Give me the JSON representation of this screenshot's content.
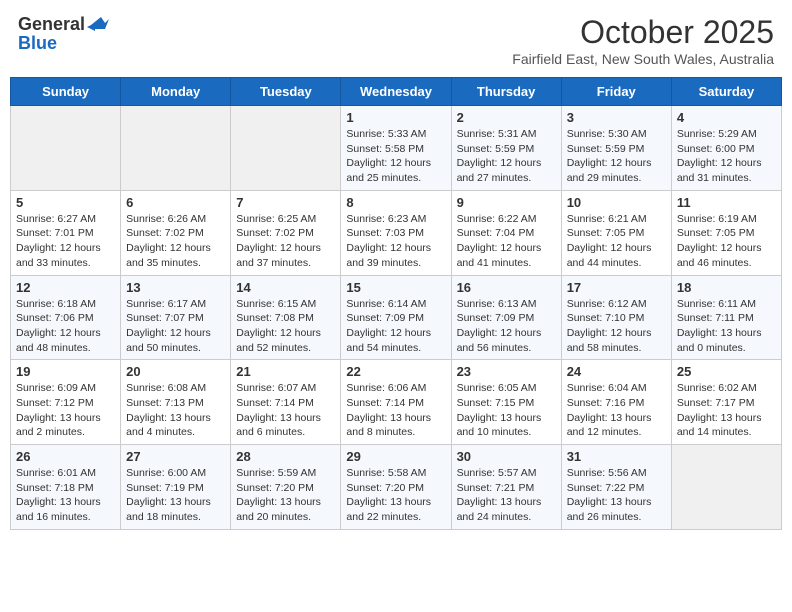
{
  "header": {
    "logo_general": "General",
    "logo_blue": "Blue",
    "month": "October 2025",
    "location": "Fairfield East, New South Wales, Australia"
  },
  "days_of_week": [
    "Sunday",
    "Monday",
    "Tuesday",
    "Wednesday",
    "Thursday",
    "Friday",
    "Saturday"
  ],
  "weeks": [
    [
      {
        "day": "",
        "info": ""
      },
      {
        "day": "",
        "info": ""
      },
      {
        "day": "",
        "info": ""
      },
      {
        "day": "1",
        "info": "Sunrise: 5:33 AM\nSunset: 5:58 PM\nDaylight: 12 hours\nand 25 minutes."
      },
      {
        "day": "2",
        "info": "Sunrise: 5:31 AM\nSunset: 5:59 PM\nDaylight: 12 hours\nand 27 minutes."
      },
      {
        "day": "3",
        "info": "Sunrise: 5:30 AM\nSunset: 5:59 PM\nDaylight: 12 hours\nand 29 minutes."
      },
      {
        "day": "4",
        "info": "Sunrise: 5:29 AM\nSunset: 6:00 PM\nDaylight: 12 hours\nand 31 minutes."
      }
    ],
    [
      {
        "day": "5",
        "info": "Sunrise: 6:27 AM\nSunset: 7:01 PM\nDaylight: 12 hours\nand 33 minutes."
      },
      {
        "day": "6",
        "info": "Sunrise: 6:26 AM\nSunset: 7:02 PM\nDaylight: 12 hours\nand 35 minutes."
      },
      {
        "day": "7",
        "info": "Sunrise: 6:25 AM\nSunset: 7:02 PM\nDaylight: 12 hours\nand 37 minutes."
      },
      {
        "day": "8",
        "info": "Sunrise: 6:23 AM\nSunset: 7:03 PM\nDaylight: 12 hours\nand 39 minutes."
      },
      {
        "day": "9",
        "info": "Sunrise: 6:22 AM\nSunset: 7:04 PM\nDaylight: 12 hours\nand 41 minutes."
      },
      {
        "day": "10",
        "info": "Sunrise: 6:21 AM\nSunset: 7:05 PM\nDaylight: 12 hours\nand 44 minutes."
      },
      {
        "day": "11",
        "info": "Sunrise: 6:19 AM\nSunset: 7:05 PM\nDaylight: 12 hours\nand 46 minutes."
      }
    ],
    [
      {
        "day": "12",
        "info": "Sunrise: 6:18 AM\nSunset: 7:06 PM\nDaylight: 12 hours\nand 48 minutes."
      },
      {
        "day": "13",
        "info": "Sunrise: 6:17 AM\nSunset: 7:07 PM\nDaylight: 12 hours\nand 50 minutes."
      },
      {
        "day": "14",
        "info": "Sunrise: 6:15 AM\nSunset: 7:08 PM\nDaylight: 12 hours\nand 52 minutes."
      },
      {
        "day": "15",
        "info": "Sunrise: 6:14 AM\nSunset: 7:09 PM\nDaylight: 12 hours\nand 54 minutes."
      },
      {
        "day": "16",
        "info": "Sunrise: 6:13 AM\nSunset: 7:09 PM\nDaylight: 12 hours\nand 56 minutes."
      },
      {
        "day": "17",
        "info": "Sunrise: 6:12 AM\nSunset: 7:10 PM\nDaylight: 12 hours\nand 58 minutes."
      },
      {
        "day": "18",
        "info": "Sunrise: 6:11 AM\nSunset: 7:11 PM\nDaylight: 13 hours\nand 0 minutes."
      }
    ],
    [
      {
        "day": "19",
        "info": "Sunrise: 6:09 AM\nSunset: 7:12 PM\nDaylight: 13 hours\nand 2 minutes."
      },
      {
        "day": "20",
        "info": "Sunrise: 6:08 AM\nSunset: 7:13 PM\nDaylight: 13 hours\nand 4 minutes."
      },
      {
        "day": "21",
        "info": "Sunrise: 6:07 AM\nSunset: 7:14 PM\nDaylight: 13 hours\nand 6 minutes."
      },
      {
        "day": "22",
        "info": "Sunrise: 6:06 AM\nSunset: 7:14 PM\nDaylight: 13 hours\nand 8 minutes."
      },
      {
        "day": "23",
        "info": "Sunrise: 6:05 AM\nSunset: 7:15 PM\nDaylight: 13 hours\nand 10 minutes."
      },
      {
        "day": "24",
        "info": "Sunrise: 6:04 AM\nSunset: 7:16 PM\nDaylight: 13 hours\nand 12 minutes."
      },
      {
        "day": "25",
        "info": "Sunrise: 6:02 AM\nSunset: 7:17 PM\nDaylight: 13 hours\nand 14 minutes."
      }
    ],
    [
      {
        "day": "26",
        "info": "Sunrise: 6:01 AM\nSunset: 7:18 PM\nDaylight: 13 hours\nand 16 minutes."
      },
      {
        "day": "27",
        "info": "Sunrise: 6:00 AM\nSunset: 7:19 PM\nDaylight: 13 hours\nand 18 minutes."
      },
      {
        "day": "28",
        "info": "Sunrise: 5:59 AM\nSunset: 7:20 PM\nDaylight: 13 hours\nand 20 minutes."
      },
      {
        "day": "29",
        "info": "Sunrise: 5:58 AM\nSunset: 7:20 PM\nDaylight: 13 hours\nand 22 minutes."
      },
      {
        "day": "30",
        "info": "Sunrise: 5:57 AM\nSunset: 7:21 PM\nDaylight: 13 hours\nand 24 minutes."
      },
      {
        "day": "31",
        "info": "Sunrise: 5:56 AM\nSunset: 7:22 PM\nDaylight: 13 hours\nand 26 minutes."
      },
      {
        "day": "",
        "info": ""
      }
    ]
  ]
}
